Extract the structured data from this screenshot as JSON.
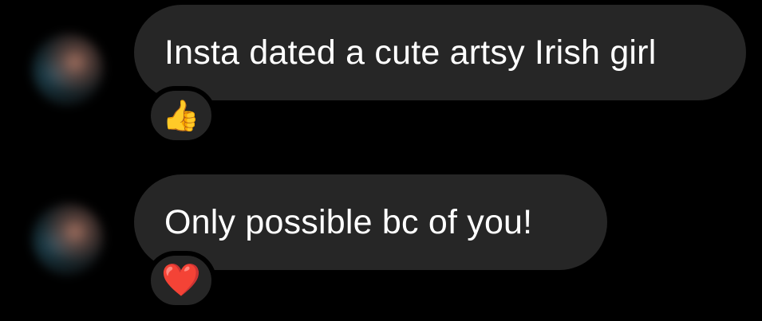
{
  "messages": [
    {
      "text": "Insta dated a cute artsy Irish girl",
      "reaction": {
        "emoji": "👍",
        "icon": "thumbs-up-icon"
      }
    },
    {
      "text": "Only possible bc of you!",
      "reaction": {
        "emoji": "❤️",
        "icon": "heart-icon"
      }
    }
  ],
  "colors": {
    "background": "#000000",
    "bubble": "#262626",
    "text": "#ffffff"
  }
}
